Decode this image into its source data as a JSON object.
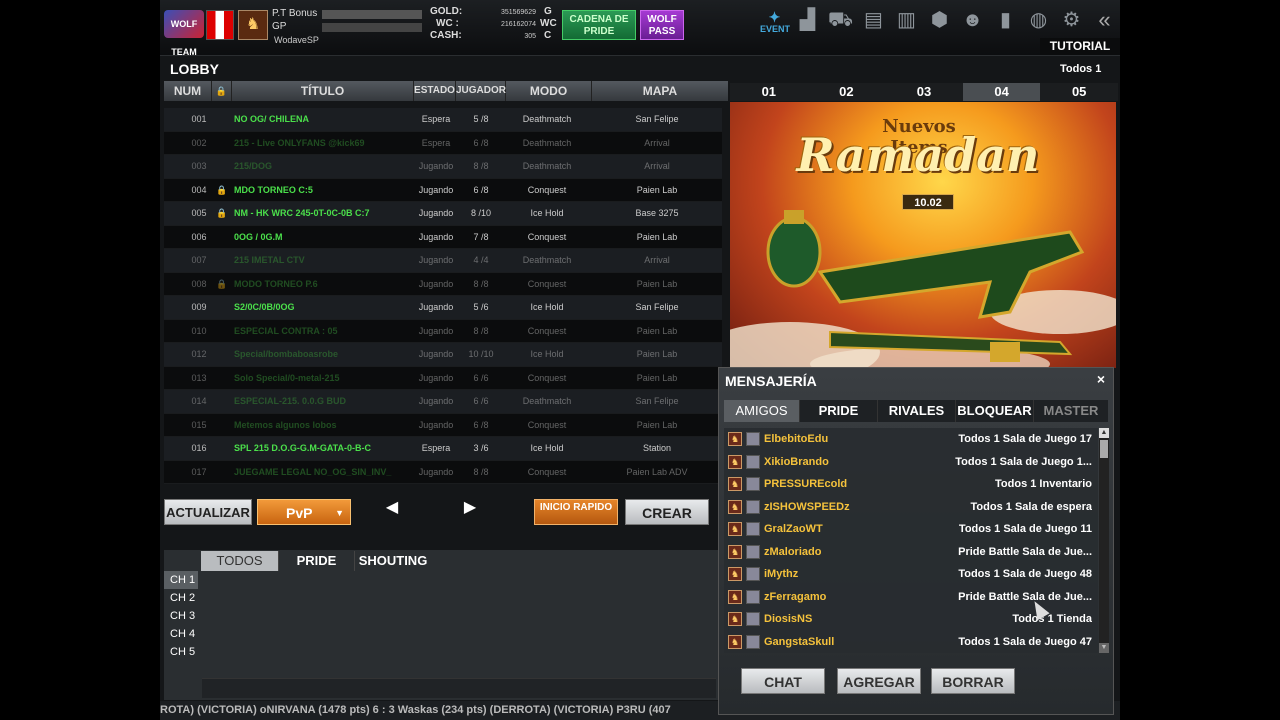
{
  "header": {
    "logo": "WOLF TEAM",
    "pt_label": "P.T Bonus",
    "gp_label": "GP",
    "nickname": "WodaveSP",
    "gold_label": "GOLD:",
    "gold_value": "351569629",
    "gold_unit": "G",
    "wc_label": "WC :",
    "wc_value": "216162074",
    "wc_unit": "WC",
    "cash_label": "CASH:",
    "cash_value": "305",
    "cash_unit": "C",
    "cadena_button": "CADENA DE PRIDE",
    "wolfpass_button": "WOLF PASS",
    "event_label": "EVENT",
    "tutorial_button": "TUTORIAL",
    "icons": [
      "event-icon",
      "ranking-icon",
      "shop-icon",
      "inventory-icon",
      "cards-icon",
      "box-icon",
      "friends-icon",
      "stats-icon",
      "world-icon",
      "settings-icon",
      "back-icon"
    ]
  },
  "lobby": {
    "title": "LOBBY",
    "filter": "Todos 1",
    "columns": [
      "NUM",
      "🔒",
      "TÍTULO",
      "ESTADO",
      "JUGADOR",
      "MODO",
      "MAPA"
    ],
    "rooms": [
      {
        "num": "001",
        "locked": false,
        "title": "NO OG/ CHILENA",
        "estado": "Espera",
        "jugador": "5 /8",
        "modo": "Deathmatch",
        "mapa": "San Felipe",
        "dim": false
      },
      {
        "num": "002",
        "locked": false,
        "title": "215 - Live ONLYFANS @kick69",
        "estado": "Espera",
        "jugador": "6 /8",
        "modo": "Deathmatch",
        "mapa": "Arrival",
        "dim": true
      },
      {
        "num": "003",
        "locked": false,
        "title": "215/DOG",
        "estado": "Jugando",
        "jugador": "8 /8",
        "modo": "Deathmatch",
        "mapa": "Arrival",
        "dim": true
      },
      {
        "num": "004",
        "locked": true,
        "title": "MDO TORNEO C:5",
        "estado": "Jugando",
        "jugador": "6 /8",
        "modo": "Conquest",
        "mapa": "Paien Lab",
        "dim": false
      },
      {
        "num": "005",
        "locked": true,
        "title": "NM - HK WRC 245-0T-0C-0B C:7",
        "estado": "Jugando",
        "jugador": "8 /10",
        "modo": "Ice Hold",
        "mapa": "Base 3275",
        "dim": false
      },
      {
        "num": "006",
        "locked": false,
        "title": "0OG / 0G.M",
        "estado": "Jugando",
        "jugador": "7 /8",
        "modo": "Conquest",
        "mapa": "Paien Lab",
        "dim": false
      },
      {
        "num": "007",
        "locked": false,
        "title": "215 IMETAL CTV",
        "estado": "Jugando",
        "jugador": "4 /4",
        "modo": "Deathmatch",
        "mapa": "Arrival",
        "dim": true
      },
      {
        "num": "008",
        "locked": true,
        "title": "MODO TORNEO P.6",
        "estado": "Jugando",
        "jugador": "8 /8",
        "modo": "Conquest",
        "mapa": "Paien Lab",
        "dim": true
      },
      {
        "num": "009",
        "locked": false,
        "title": "S2/0C/0B/0OG",
        "estado": "Jugando",
        "jugador": "5 /6",
        "modo": "Ice Hold",
        "mapa": "San Felipe",
        "dim": false
      },
      {
        "num": "010",
        "locked": false,
        "title": "ESPECIAL CONTRA : 05",
        "estado": "Jugando",
        "jugador": "8 /8",
        "modo": "Conquest",
        "mapa": "Paien Lab",
        "dim": true
      },
      {
        "num": "012",
        "locked": false,
        "title": "Special/bombaboasrobe",
        "estado": "Jugando",
        "jugador": "10 /10",
        "modo": "Ice Hold",
        "mapa": "Paien Lab",
        "dim": true
      },
      {
        "num": "013",
        "locked": false,
        "title": "Solo Special/0-metal-215",
        "estado": "Jugando",
        "jugador": "6 /6",
        "modo": "Conquest",
        "mapa": "Paien Lab",
        "dim": true
      },
      {
        "num": "014",
        "locked": false,
        "title": "ESPECIAL-215. 0.0.G BUD",
        "estado": "Jugando",
        "jugador": "6 /6",
        "modo": "Deathmatch",
        "mapa": "San Felipe",
        "dim": true
      },
      {
        "num": "015",
        "locked": false,
        "title": "Metemos algunos lobos",
        "estado": "Jugando",
        "jugador": "6 /8",
        "modo": "Conquest",
        "mapa": "Paien Lab",
        "dim": true
      },
      {
        "num": "016",
        "locked": false,
        "title": "SPL 215 D.O.G-G.M-GATA-0-B-C",
        "estado": "Espera",
        "jugador": "3 /6",
        "modo": "Ice Hold",
        "mapa": "Station",
        "dim": false
      },
      {
        "num": "017",
        "locked": false,
        "title": "JUEGAME LEGAL NO_OG_SIN_INV_",
        "estado": "Jugando",
        "jugador": "8 /8",
        "modo": "Conquest",
        "mapa": "Paien Lab ADV",
        "dim": true
      }
    ],
    "buttons": {
      "actualizar": "ACTUALIZAR",
      "pvp": "PvP",
      "prev": "◀",
      "next": "▶",
      "inicio_rapido": "INICIO RAPIDO",
      "crear": "CREAR"
    }
  },
  "banner": {
    "tabs": [
      "01",
      "02",
      "03",
      "04",
      "05"
    ],
    "active_tab": "04",
    "subtitle": "Nuevos Items",
    "title": "Ramadan",
    "date": "10.02"
  },
  "chat": {
    "tabs": [
      "TODOS",
      "PRIDE",
      "SHOUTING"
    ],
    "active_tab": "TODOS",
    "channels": [
      "CH 1",
      "CH 2",
      "CH 3",
      "CH 4",
      "CH 5"
    ],
    "ticker": "ROTA)     (VICTORIA) oNIRVANA (1478 pts) 6 : 3 Waskas (234 pts) (DERROTA)          (VICTORIA) P3RU (407"
  },
  "messaging": {
    "title": "MENSAJERÍA",
    "close": "×",
    "tabs": [
      "AMIGOS",
      "PRIDE",
      "RIVALES",
      "BLOQUEAR",
      "MASTER"
    ],
    "active_tab": "AMIGOS",
    "friends": [
      {
        "name": "ElbebitoEdu",
        "location": "Todos 1 Sala de Juego 17"
      },
      {
        "name": "XikioBrando",
        "location": "Todos 1 Sala de Juego 1..."
      },
      {
        "name": "PRESSUREcold",
        "location": "Todos 1 Inventario"
      },
      {
        "name": "zISHOWSPEEDz",
        "location": "Todos 1 Sala de espera"
      },
      {
        "name": "GralZaoWT",
        "location": "Todos 1 Sala de Juego 11"
      },
      {
        "name": "zMaloriado",
        "location": "Pride Battle Sala de Jue..."
      },
      {
        "name": "iMythz",
        "location": "Todos 1 Sala de Juego 48"
      },
      {
        "name": "zFerragamo",
        "location": "Pride Battle Sala de Jue..."
      },
      {
        "name": "DiosisNS",
        "location": "Todos 1 Tienda"
      },
      {
        "name": "GangstaSkull",
        "location": "Todos 1 Sala de Juego 47"
      }
    ],
    "buttons": {
      "chat": "CHAT",
      "agregar": "AGREGAR",
      "borrar": "BORRAR"
    }
  }
}
